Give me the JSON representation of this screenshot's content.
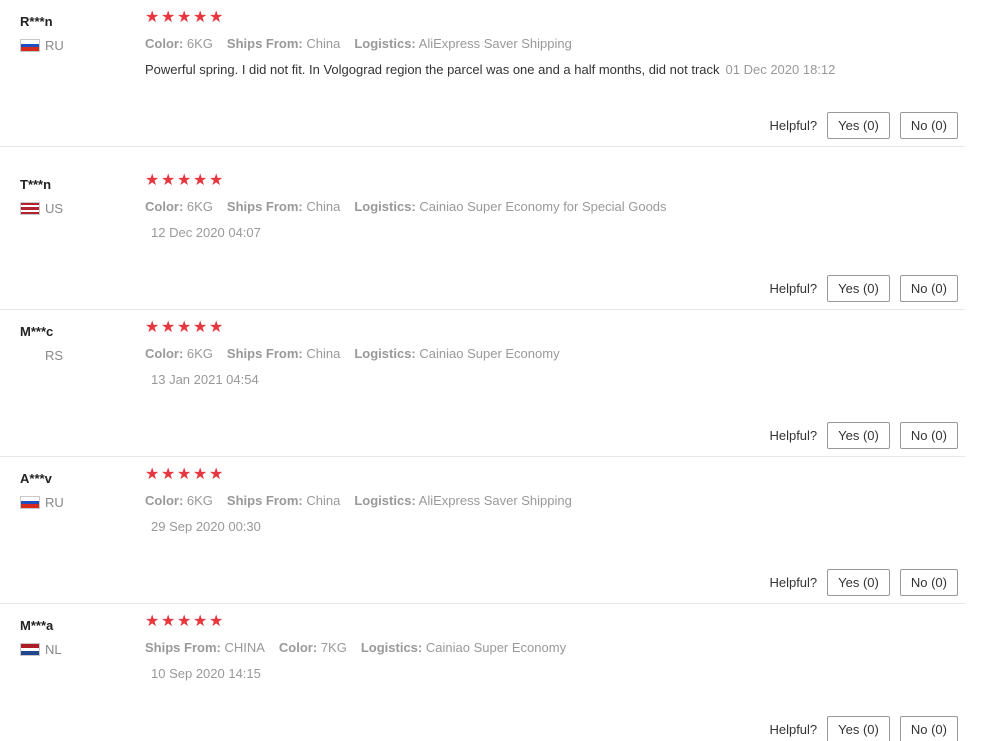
{
  "helpful_label": "Helpful?",
  "reviews": [
    {
      "user": "R***n",
      "country": "RU",
      "rating": 5,
      "meta": [
        {
          "label": "Color:",
          "value": "6KG"
        },
        {
          "label": "Ships From:",
          "value": "China"
        },
        {
          "label": "Logistics:",
          "value": "AliExpress Saver Shipping"
        }
      ],
      "text": "Powerful spring. I did not fit. In Volgograd region the parcel was one and a half months, did not track",
      "date": "01 Dec 2020 18:12",
      "yes": "Yes (0)",
      "no": "No (0)"
    },
    {
      "user": "T***n",
      "country": "US",
      "rating": 5,
      "meta": [
        {
          "label": "Color:",
          "value": "6KG"
        },
        {
          "label": "Ships From:",
          "value": "China"
        },
        {
          "label": "Logistics:",
          "value": "Cainiao Super Economy for Special Goods"
        }
      ],
      "text": "",
      "date": "12 Dec 2020 04:07",
      "yes": "Yes (0)",
      "no": "No (0)"
    },
    {
      "user": "M***c",
      "country": "RS",
      "rating": 5,
      "meta": [
        {
          "label": "Color:",
          "value": "6KG"
        },
        {
          "label": "Ships From:",
          "value": "China"
        },
        {
          "label": "Logistics:",
          "value": "Cainiao Super Economy"
        }
      ],
      "text": "",
      "date": "13 Jan 2021 04:54",
      "yes": "Yes (0)",
      "no": "No (0)"
    },
    {
      "user": "A***v",
      "country": "RU",
      "rating": 5,
      "meta": [
        {
          "label": "Color:",
          "value": "6KG"
        },
        {
          "label": "Ships From:",
          "value": "China"
        },
        {
          "label": "Logistics:",
          "value": "AliExpress Saver Shipping"
        }
      ],
      "text": "",
      "date": "29 Sep 2020 00:30",
      "yes": "Yes (0)",
      "no": "No (0)"
    },
    {
      "user": "M***a",
      "country": "NL",
      "rating": 5,
      "meta": [
        {
          "label": "Ships From:",
          "value": "CHINA"
        },
        {
          "label": "Color:",
          "value": "7KG"
        },
        {
          "label": "Logistics:",
          "value": "Cainiao Super Economy"
        }
      ],
      "text": "",
      "date": "10 Sep 2020 14:15",
      "yes": "Yes (0)",
      "no": "No (0)"
    }
  ],
  "flags": {
    "RU": [
      "#ffffff",
      "#1f4fbf",
      "#d52b1e"
    ],
    "US": [
      "#b22234",
      "#ffffff",
      "#b22234",
      "#ffffff",
      "#b22234"
    ],
    "NL": [
      "#ae1c28",
      "#ffffff",
      "#21468b"
    ],
    "RS": []
  },
  "colors": {
    "star": "#e8363f",
    "divider": "#e8e8e8",
    "muted_text": "#999999"
  },
  "icons": {
    "star": "star-icon",
    "flag": "country-flag-icon"
  }
}
